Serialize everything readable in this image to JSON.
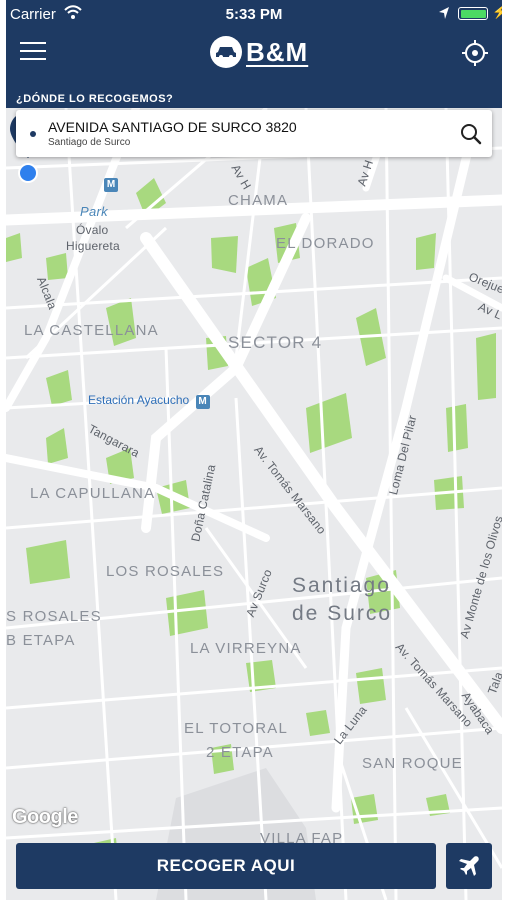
{
  "status_bar": {
    "carrier": "Carrier",
    "time": "5:33 PM",
    "battery_level": 1.0
  },
  "header": {
    "brand": "B&M",
    "pickup_prompt": "¿DÓNDE LO RECOGEMOS?"
  },
  "search": {
    "address": "AVENIDA SANTIAGO DE SURCO 3820",
    "district": "Santiago de Surco"
  },
  "map": {
    "labels": {
      "chama": "CHAMA",
      "el_dorado": "EL DORADO",
      "la_castellana": "LA CASTELLANA",
      "sector_4": "SECTOR 4",
      "la_capullana": "LA CAPULLANA",
      "los_rosales": "LOS ROSALES",
      "s_rosales": "S ROSALES",
      "b_etapa": "B ETAPA",
      "la_virreyna": "LA VIRREYNA",
      "el_totoral": "EL TOTORAL",
      "dos_etapa": "2 ETAPA",
      "san_roque": "SAN ROQUE",
      "villa_fap": "VILLA FAP",
      "santiago": "Santiago",
      "de_surco": "de Surco",
      "park": "Park",
      "ovalo": "Óvalo",
      "higuereta": "Higuereta",
      "estacion": "Estación Ayacucho",
      "alcala": "Alcala",
      "tangarara": "Tangarara",
      "dona_catalina": "Doña Catalina",
      "av_tomas_marsano": "Av. Tomás Marsano",
      "av_surco": "Av Surco",
      "loma_del_pilar": "Loma Del Pilar",
      "av_monte_olivos": "Av Monte de los Olivos",
      "av_tomas_marsano_2": "Av. Tomás Marsano",
      "ayabaca": "Ayabaca",
      "la_luna": "La Luna",
      "orejue": "Orejue",
      "av_h": "Av H",
      "av_h2": "Av H",
      "av_l": "Av L",
      "tala": "Tala",
      "m_badge": "M",
      "m_badge2": "M"
    },
    "attribution": "Google"
  },
  "actions": {
    "pickup_button": "RECOGER AQUI"
  },
  "colors": {
    "brand_navy": "#1e3a63",
    "park_green": "#a8d97f",
    "road_white": "#ffffff",
    "map_bg": "#e9eaec"
  },
  "icons": {
    "menu": "hamburger-icon",
    "locate": "crosshair-icon",
    "search": "search-icon",
    "pin": "user-pin-icon",
    "airport": "airplane-icon"
  }
}
